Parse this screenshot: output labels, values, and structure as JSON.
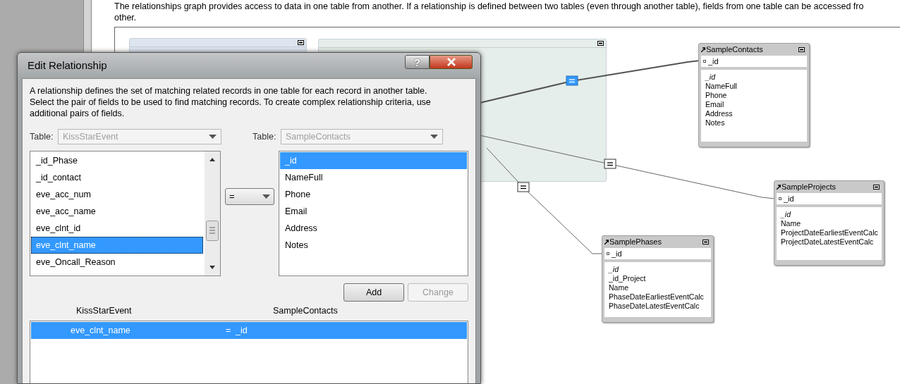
{
  "intro": "The relationships graph provides access to data in one table from another. If a relationship is defined between two tables (even through another table), fields from one table can be accessed fro\nother.",
  "graph": {
    "groups": [
      {
        "color": "#dde5f0"
      },
      {
        "color": "#e5eeea"
      }
    ],
    "tables": [
      {
        "name": "SampleContacts",
        "match_field": "_id",
        "fields": [
          {
            "name": "_id",
            "match": true
          },
          {
            "name": "NameFull",
            "match": false
          },
          {
            "name": "Phone",
            "match": false
          },
          {
            "name": "Email",
            "match": false
          },
          {
            "name": "Address",
            "match": false
          },
          {
            "name": "Notes",
            "match": false
          }
        ]
      },
      {
        "name": "SampleProjects",
        "match_field": "_id",
        "fields": [
          {
            "name": "_id",
            "match": true
          },
          {
            "name": "Name",
            "match": false
          },
          {
            "name": "ProjectDateEarliestEventCalc",
            "match": false
          },
          {
            "name": "ProjectDateLatestEventCalc",
            "match": false
          }
        ]
      },
      {
        "name": "SamplePhases",
        "match_field": "_id",
        "fields": [
          {
            "name": "_id",
            "match": true
          },
          {
            "name": "_id_Project",
            "match": false
          },
          {
            "name": "Name",
            "match": false
          },
          {
            "name": "PhaseDateEarliestEventCalc",
            "match": false
          },
          {
            "name": "PhaseDateLatestEventCalc",
            "match": false
          }
        ]
      }
    ],
    "relationships": [
      {
        "selected": true
      },
      {
        "selected": false
      },
      {
        "selected": false
      }
    ]
  },
  "dialog": {
    "title": "Edit Relationship",
    "help": "?",
    "description": "A relationship defines the set of matching related records in one table for each record in another table.\nSelect the pair of fields to be used to find matching records. To create complex relationship criteria, use\nadditional pairs of fields.",
    "left_table": {
      "label": "Table:",
      "value": "KissStarEvent",
      "disabled": true
    },
    "right_table": {
      "label": "Table:",
      "value": "SampleContacts",
      "disabled": true
    },
    "left_fields": [
      {
        "name": "_id_Phase",
        "selected": false
      },
      {
        "name": "_id_contact",
        "selected": false
      },
      {
        "name": "eve_acc_num",
        "selected": false
      },
      {
        "name": "eve_acc_name",
        "selected": false
      },
      {
        "name": "eve_clnt_id",
        "selected": false
      },
      {
        "name": "eve_clnt_name",
        "selected": true
      },
      {
        "name": "eve_Oncall_Reason",
        "selected": false
      }
    ],
    "operator": "=",
    "right_fields": [
      {
        "name": "_id",
        "selected": true
      },
      {
        "name": "NameFull",
        "selected": false
      },
      {
        "name": "Phone",
        "selected": false
      },
      {
        "name": "Email",
        "selected": false
      },
      {
        "name": "Address",
        "selected": false
      },
      {
        "name": "Notes",
        "selected": false
      }
    ],
    "buttons": [
      {
        "label": "Add",
        "disabled": false
      },
      {
        "label": "Change",
        "disabled": true
      }
    ],
    "criteria": {
      "columns": [
        "KissStarEvent",
        "SampleContacts"
      ],
      "rows": [
        {
          "left": "eve_clnt_name",
          "operator": "=",
          "right": "_id",
          "selected": true
        }
      ]
    }
  }
}
